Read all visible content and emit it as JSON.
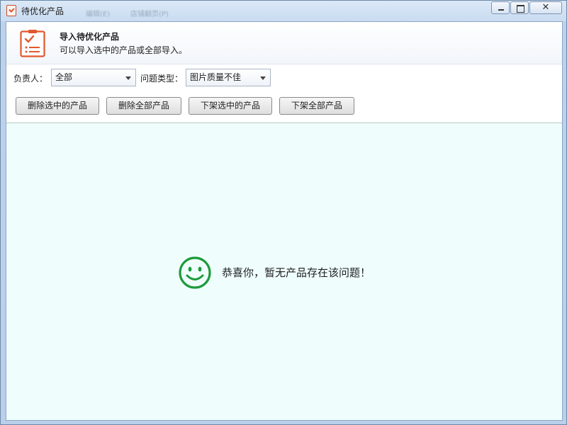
{
  "window": {
    "title": "待优化产品",
    "ghost_tabs": [
      "编辑(E)",
      "店铺翻页(P)"
    ],
    "controls": {
      "minimize": "minimize-icon",
      "maximize": "maximize-icon",
      "close": "close-icon"
    }
  },
  "header": {
    "icon": "checklist-icon",
    "title": "导入待优化产品",
    "subtitle": "可以导入选中的产品或全部导入。"
  },
  "filters": {
    "owner_label": "负责人：",
    "owner_value": "全部",
    "issue_label": "问题类型：",
    "issue_value": "图片质量不佳"
  },
  "actions": {
    "delete_selected": "删除选中的产品",
    "delete_all": "删除全部产品",
    "unlist_selected": "下架选中的产品",
    "unlist_all": "下架全部产品"
  },
  "empty_state": {
    "icon": "smiley-icon",
    "message": "恭喜你，暂无产品存在该问题！"
  },
  "colors": {
    "accent_icon": "#e2582c",
    "success_icon": "#1d9a3a",
    "content_bg": "#effefd"
  }
}
